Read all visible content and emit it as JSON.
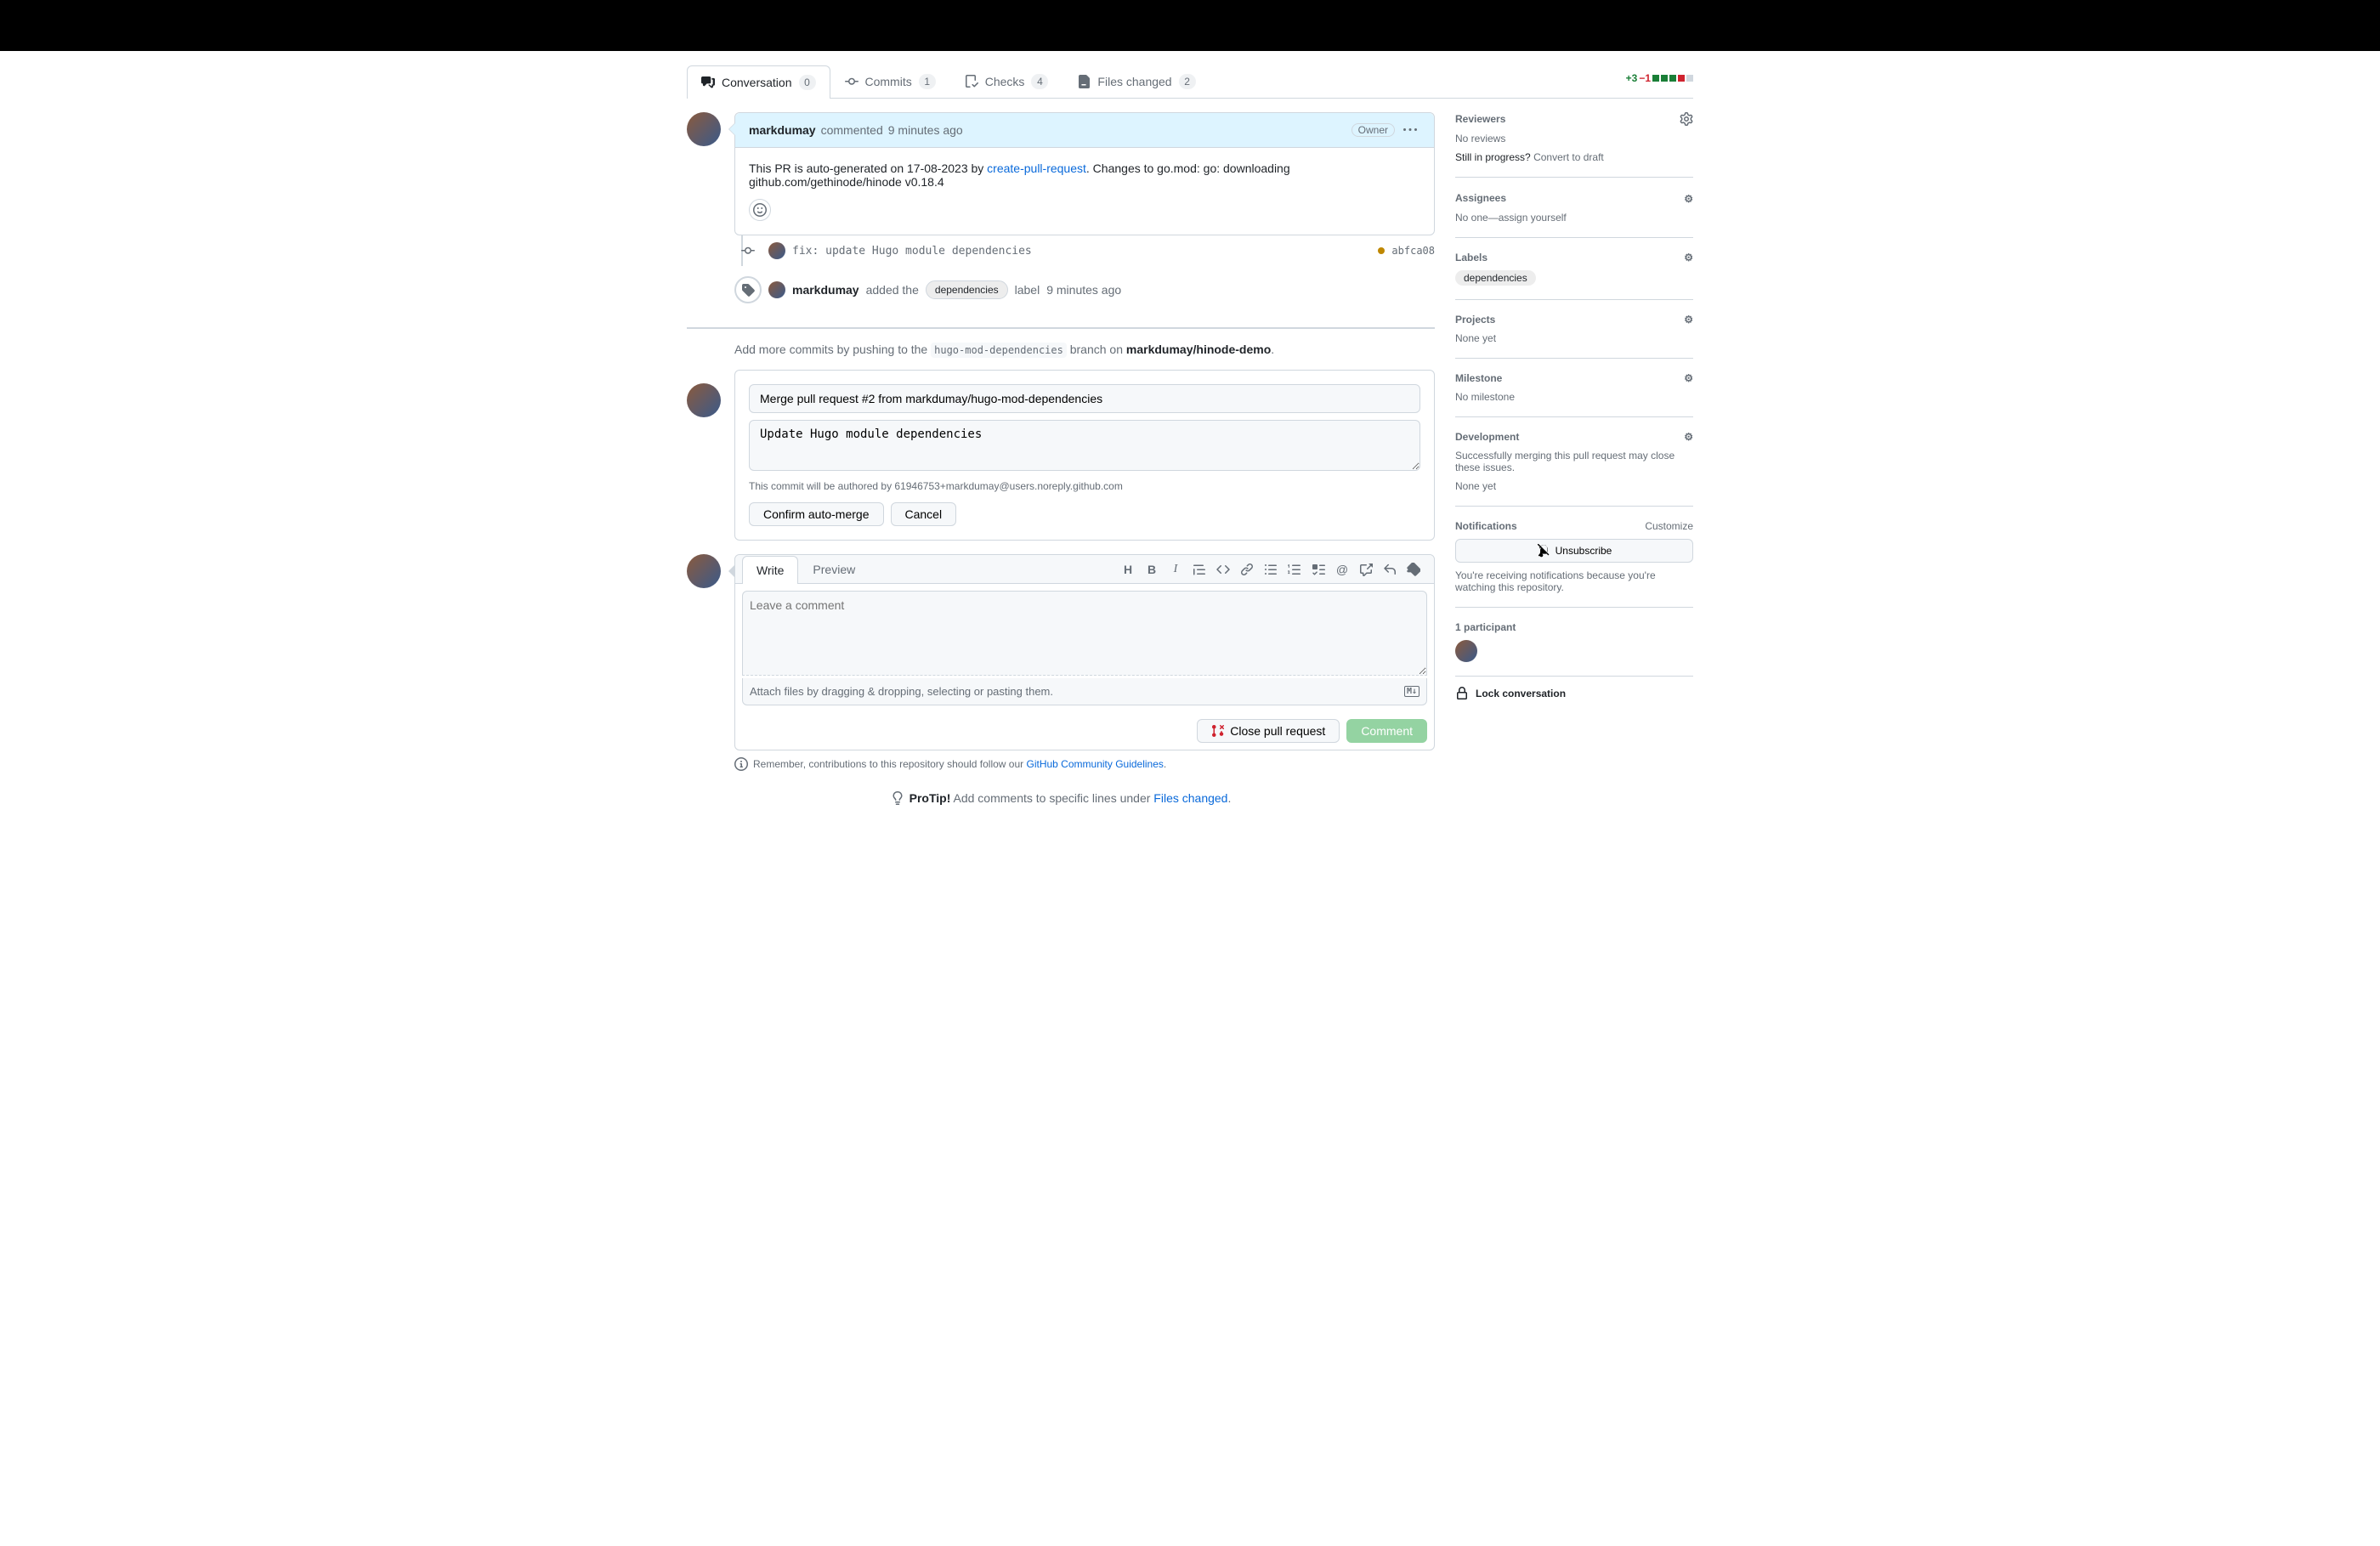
{
  "tabs": {
    "conversation": {
      "label": "Conversation",
      "count": "0"
    },
    "commits": {
      "label": "Commits",
      "count": "1"
    },
    "checks": {
      "label": "Checks",
      "count": "4"
    },
    "files": {
      "label": "Files changed",
      "count": "2"
    }
  },
  "diffstat": {
    "add": "+3",
    "del": "−1"
  },
  "comment": {
    "author": "markdumay",
    "action": "commented",
    "time": "9 minutes ago",
    "owner": "Owner",
    "body_pre": "This PR is auto-generated on 17-08-2023 by ",
    "body_link": "create-pull-request",
    "body_post": ". Changes to go.mod: go: downloading github.com/gethinode/hinode v0.18.4"
  },
  "commit": {
    "msg": "fix: update Hugo module dependencies",
    "sha": "abfca08"
  },
  "label_event": {
    "author": "markdumay",
    "pre": "added the",
    "label": "dependencies",
    "post": "label",
    "time": "9 minutes ago"
  },
  "push_more": {
    "pre": "Add more commits by pushing to the",
    "branch": "hugo-mod-dependencies",
    "mid": "branch on",
    "repo": "markdumay/hinode-demo"
  },
  "merge": {
    "title": "Merge pull request #2 from markdumay/hugo-mod-dependencies",
    "desc": "Update Hugo module dependencies",
    "note": "This commit will be authored by 61946753+markdumay@users.noreply.github.com",
    "confirm": "Confirm auto-merge",
    "cancel": "Cancel"
  },
  "form": {
    "write": "Write",
    "preview": "Preview",
    "placeholder": "Leave a comment",
    "attach": "Attach files by dragging & dropping, selecting or pasting them.",
    "close": "Close pull request",
    "comment": "Comment"
  },
  "guidelines": {
    "pre": "Remember, contributions to this repository should follow our ",
    "link": "GitHub Community Guidelines"
  },
  "protip": {
    "strong": "ProTip!",
    "text": " Add comments to specific lines under ",
    "link": "Files changed"
  },
  "sidebar": {
    "reviewers": {
      "title": "Reviewers",
      "text": "No reviews",
      "progress": "Still in progress?",
      "convert": "Convert to draft"
    },
    "assignees": {
      "title": "Assignees",
      "noone": "No one—",
      "assign": "assign yourself"
    },
    "labels": {
      "title": "Labels",
      "chip": "dependencies"
    },
    "projects": {
      "title": "Projects",
      "text": "None yet"
    },
    "milestone": {
      "title": "Milestone",
      "text": "No milestone"
    },
    "development": {
      "title": "Development",
      "text": "Successfully merging this pull request may close these issues.",
      "none": "None yet"
    },
    "notifications": {
      "title": "Notifications",
      "customize": "Customize",
      "unsubscribe": "Unsubscribe",
      "note": "You're receiving notifications because you're watching this repository."
    },
    "participants": {
      "title": "1 participant"
    },
    "lock": "Lock conversation"
  }
}
